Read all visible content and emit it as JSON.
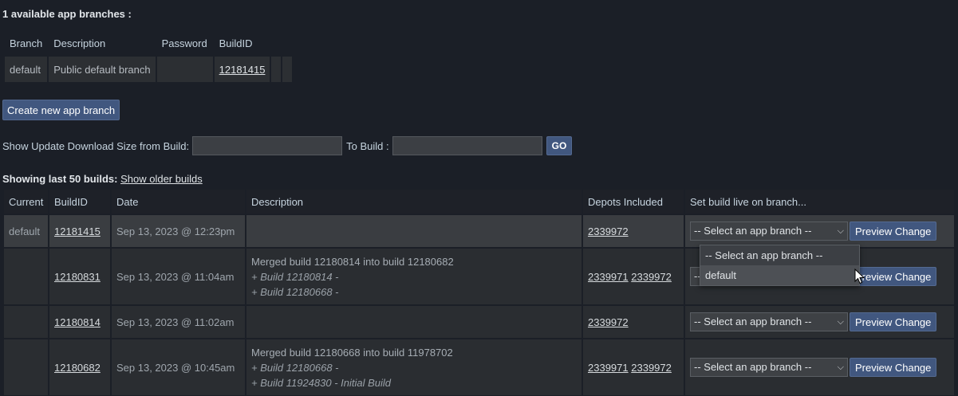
{
  "branches_heading": "1 available app branches :",
  "branch_table": {
    "headers": [
      "Branch",
      "Description",
      "Password",
      "BuildID"
    ],
    "rows": [
      {
        "branch": "default",
        "description": "Public default branch",
        "password": "",
        "buildid": "12181415"
      }
    ]
  },
  "create_branch_label": "Create new app branch",
  "size_row": {
    "from_label": "Show Update Download Size from Build:",
    "from_value": "",
    "to_label": "To Build :",
    "to_value": "",
    "go_label": "GO"
  },
  "builds_heading": {
    "prefix": "Showing last 50 builds:",
    "older_link": "Show older builds"
  },
  "builds_table": {
    "headers": [
      "Current",
      "BuildID",
      "Date",
      "Description",
      "Depots Included",
      "Set build live on branch..."
    ],
    "select_placeholder": "-- Select an app branch --",
    "preview_label": "Preview Change",
    "rows": [
      {
        "current": "default",
        "buildid": "12181415",
        "date": "Sep 13, 2023 @ 12:23pm",
        "desc_main": "",
        "desc_sub": [],
        "depots": [
          "2339972"
        ]
      },
      {
        "current": "",
        "buildid": "12180831",
        "date": "Sep 13, 2023 @ 11:04am",
        "desc_main": "Merged build 12180814 into build 12180682",
        "desc_sub": [
          "+ Build 12180814 -",
          "+ Build 12180668 -"
        ],
        "depots": [
          "2339971",
          "2339972"
        ]
      },
      {
        "current": "",
        "buildid": "12180814",
        "date": "Sep 13, 2023 @ 11:02am",
        "desc_main": "",
        "desc_sub": [],
        "depots": [
          "2339972"
        ]
      },
      {
        "current": "",
        "buildid": "12180682",
        "date": "Sep 13, 2023 @ 10:45am",
        "desc_main": "Merged build 12180668 into build 11978702",
        "desc_sub": [
          "+ Build 12180668 -",
          "+ Build 11924830 - Initial Build"
        ],
        "depots": [
          "2339971",
          "2339972"
        ]
      }
    ]
  },
  "dropdown_options": [
    "-- Select an app branch --",
    "default"
  ]
}
